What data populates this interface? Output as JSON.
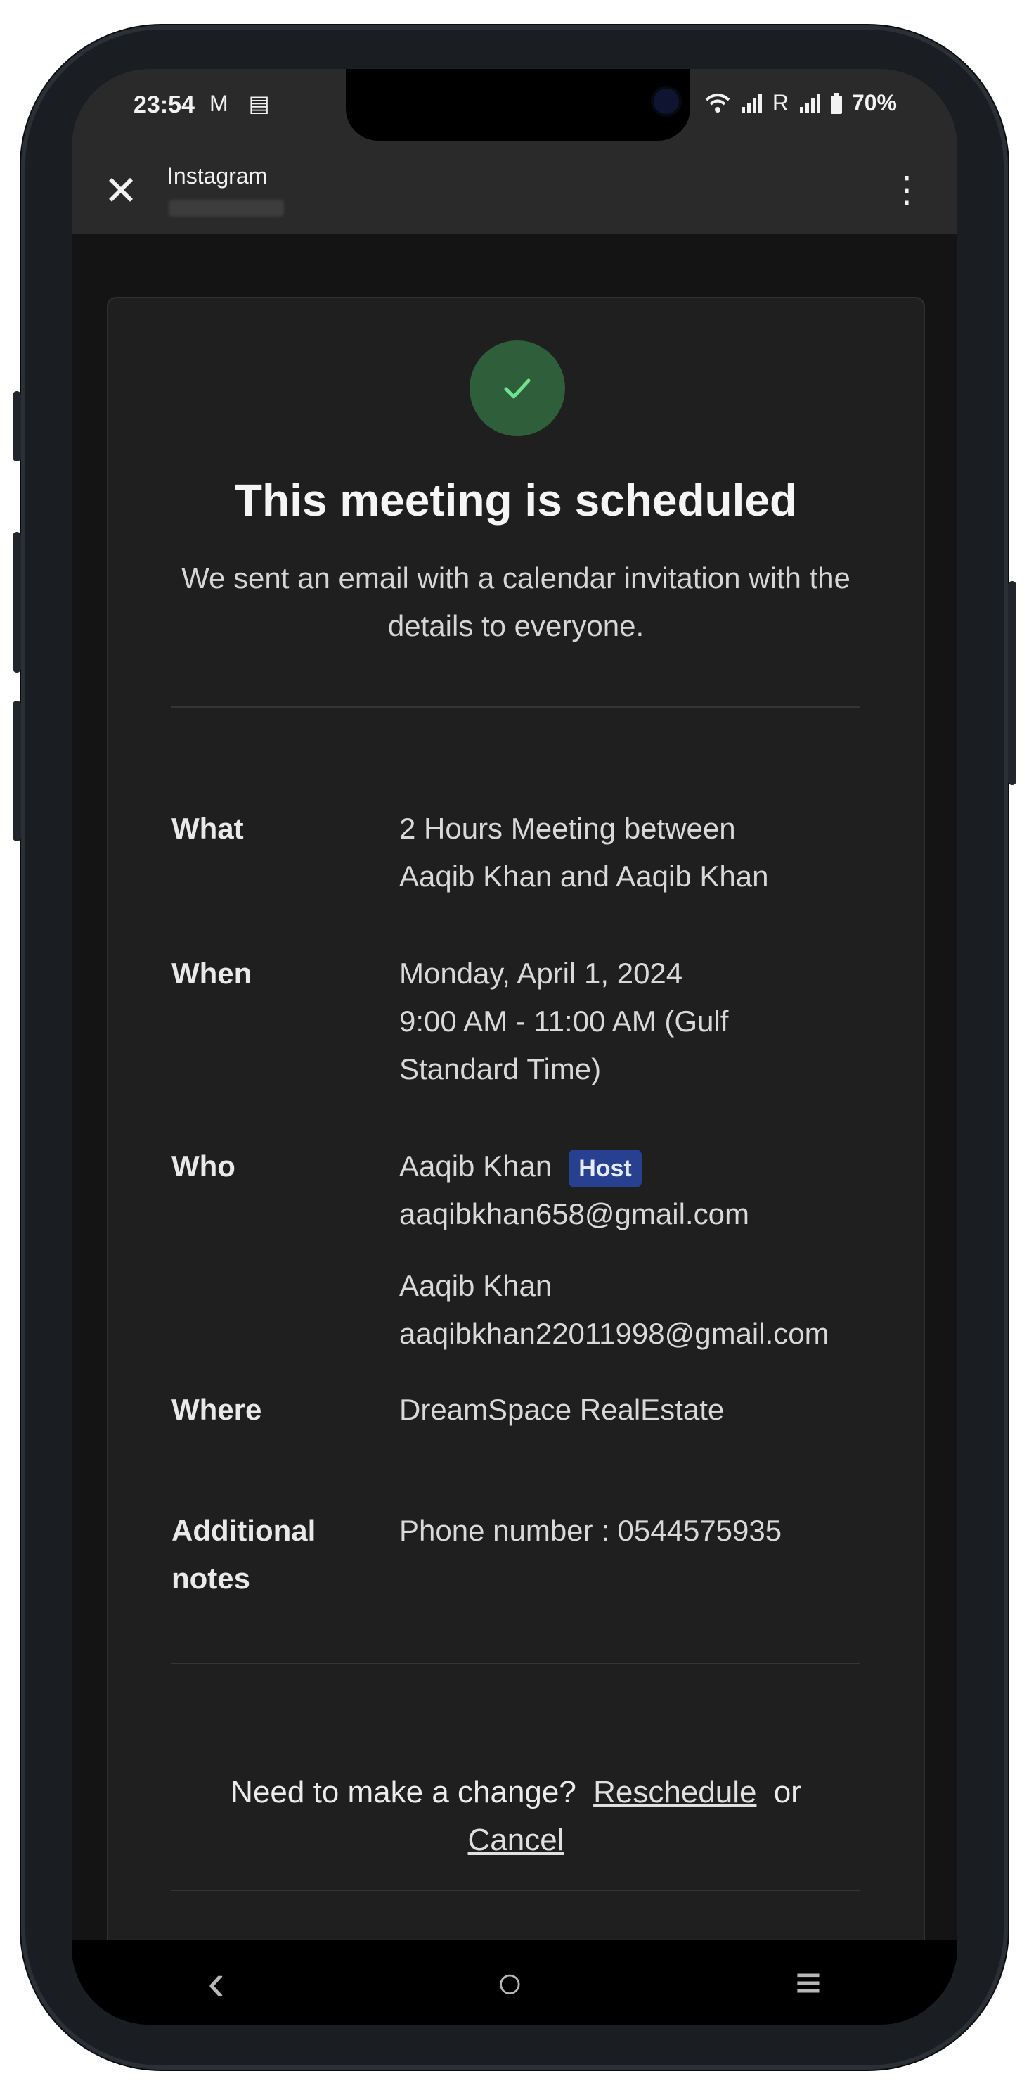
{
  "status_bar": {
    "time": "23:54",
    "left_icons": [
      "gmail-icon",
      "calendar-icon"
    ],
    "battery": "70%",
    "carrier_indicator": "R"
  },
  "app_bar": {
    "title": "Instagram",
    "close_glyph": "✕",
    "more_glyph": "⋮"
  },
  "confirmation": {
    "headline": "This meeting is scheduled",
    "subline": "We sent an email with a calendar invitation with the details to everyone.",
    "accent_color": "#2e5e3a",
    "check_color": "#6fe38f"
  },
  "details": {
    "what": {
      "label": "What",
      "value_line1": "2 Hours Meeting between",
      "value_line2": "Aaqib Khan and Aaqib Khan"
    },
    "when": {
      "label": "When",
      "date": "Monday, April 1, 2024",
      "time_line1": "9:00 AM - 11:00 AM (Gulf",
      "time_line2": "Standard Time)"
    },
    "who": {
      "label": "Who",
      "host_name": "Aaqib Khan",
      "host_badge": "Host",
      "host_email": "aaqibkhan658@gmail.com",
      "guest_name": "Aaqib Khan",
      "guest_email": "aaqibkhan22011998@gmail.com"
    },
    "where": {
      "label": "Where",
      "value": "DreamSpace RealEstate"
    },
    "notes": {
      "label_line1": "Additional",
      "label_line2": "notes",
      "value": "Phone number : 0544575935"
    }
  },
  "change": {
    "prompt": "Need to make a change?",
    "reschedule": "Reschedule",
    "or": "or",
    "cancel": "Cancel"
  },
  "nav_bar": {
    "back_glyph": "‹",
    "home_glyph": "○",
    "menu_glyph": "≡"
  }
}
